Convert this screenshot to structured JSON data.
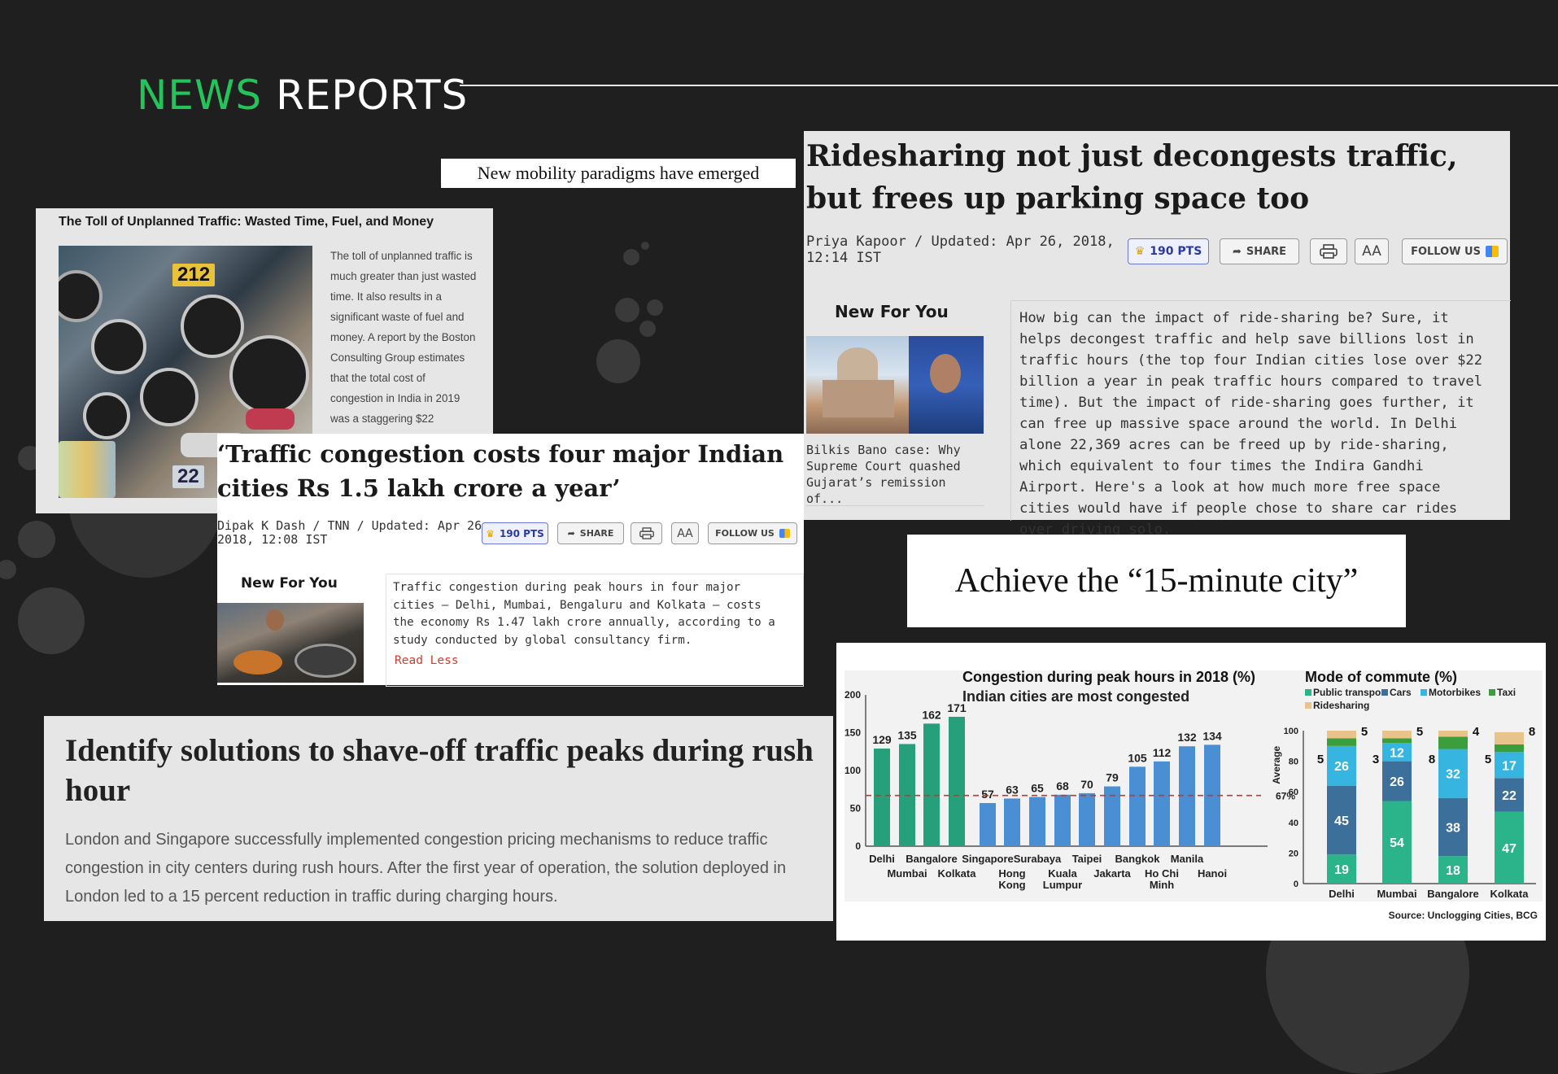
{
  "header": {
    "title_accent": "NEWS",
    "title_rest": " REPORTS"
  },
  "banners": {
    "mobility": "New mobility paradigms have emerged",
    "fifteen_min": "Achieve the “15-minute city”"
  },
  "card_toll": {
    "heading": "The Toll of Unplanned Traffic: Wasted Time, Fuel, and Money",
    "image_tag_1": "212",
    "image_tag_2": "22",
    "body": "The toll of unplanned traffic is much greater than just wasted time. It also results in a significant waste of fuel and money. A report by the Boston Consulting Group estimates that the total cost of congestion in India in 2019 was a staggering $22"
  },
  "article_ridesharing": {
    "headline": "Ridesharing not just decongests traffic, but frees up parking space too",
    "meta_line1": "Priya Kapoor / Updated: Apr 26, 2018,",
    "meta_line2": "12:14 IST",
    "pts": "190 PTS",
    "share": "SHARE",
    "aa": "AA",
    "follow": "FOLLOW US",
    "new_for_you": "New For You",
    "thumb_caption": "Bilkis Bano case: Why Supreme Court quashed Gujarat’s remission of...",
    "body": "How big can the impact of ride-sharing be? Sure, it helps decongest traffic and help save billions lost in traffic hours (the top four Indian cities lose over $22 billion a year in peak traffic hours compared to travel time). But the impact of ride-sharing goes further, it can free up massive space around the world. In Delhi alone 22,369 acres can be freed up by ride-sharing, which equivalent to four times the Indira Gandhi Airport. Here's a look at how much more free space cities would have if people chose to share car rides over driving solo."
  },
  "article_congestion": {
    "headline": "‘Traffic congestion costs four major Indian cities Rs 1.5 lakh crore a year’",
    "meta_line1": "Dipak K Dash / TNN / Updated: Apr 26,",
    "meta_line2": "2018, 12:08 IST",
    "pts": "190 PTS",
    "share": "SHARE",
    "aa": "AA",
    "follow": "FOLLOW US",
    "new_for_you": "New For You",
    "body": "Traffic congestion during peak hours in four major cities — Delhi, Mumbai, Bengaluru and Kolkata — costs the economy Rs 1.47 lakh crore annually, according to a study conducted by global consultancy firm.",
    "read_less": "Read Less"
  },
  "solutions": {
    "heading": "Identify solutions to shave-off traffic peaks during rush hour",
    "body": "London and Singapore successfully implemented congestion pricing mechanisms to reduce traffic congestion in city centers during rush hours. After the first year of operation, the solution deployed in London led to a 15 percent reduction in traffic during charging hours."
  },
  "chart_data": [
    {
      "type": "bar",
      "title": "Congestion during peak hours in 2018 (%)",
      "subtitle": "Indian cities are most congested",
      "categories": [
        "Delhi",
        "Mumbai",
        "Bangalore",
        "Kolkata",
        "Singapore",
        "Hong Kong",
        "Surabaya",
        "Kuala Lumpur",
        "Taipei",
        "Jakarta",
        "Bangkok",
        "Ho Chi Minh",
        "Manila",
        "Hanoi"
      ],
      "values": [
        129,
        135,
        162,
        171,
        57,
        63,
        65,
        68,
        70,
        79,
        105,
        112,
        132,
        134
      ],
      "colors": [
        "#26a07a",
        "#26a07a",
        "#26a07a",
        "#26a07a",
        "#4a8fd4",
        "#4a8fd4",
        "#4a8fd4",
        "#4a8fd4",
        "#4a8fd4",
        "#4a8fd4",
        "#4a8fd4",
        "#4a8fd4",
        "#4a8fd4",
        "#4a8fd4"
      ],
      "yticks": [
        "0",
        "50",
        "100",
        "150",
        "200"
      ],
      "ylim": [
        0,
        200
      ],
      "reference_line": {
        "value": 67,
        "label": "Average",
        "value_label": "67%",
        "color": "#c0392b"
      }
    },
    {
      "type": "bar",
      "stacked": true,
      "title": "Mode of commute (%)",
      "categories": [
        "Delhi",
        "Mumbai",
        "Bangalore",
        "Kolkata"
      ],
      "series": [
        {
          "name": "Public transport",
          "color": "#2bb38a",
          "values": [
            19,
            54,
            18,
            47
          ]
        },
        {
          "name": "Cars",
          "color": "#3c6f99",
          "values": [
            45,
            26,
            38,
            22
          ]
        },
        {
          "name": "Motorbikes",
          "color": "#35b5e0",
          "values": [
            26,
            12,
            32,
            17
          ]
        },
        {
          "name": "Taxi",
          "color": "#3b9e3b",
          "values": [
            5,
            3,
            8,
            5
          ]
        },
        {
          "name": "Ridesharing",
          "color": "#e8c48a",
          "values": [
            5,
            5,
            4,
            8
          ]
        }
      ],
      "yticks": [
        "0",
        "20",
        "40",
        "60",
        "80",
        "100"
      ],
      "ylim": [
        0,
        100
      ],
      "source": "Source: Unclogging Cities, BCG"
    }
  ]
}
